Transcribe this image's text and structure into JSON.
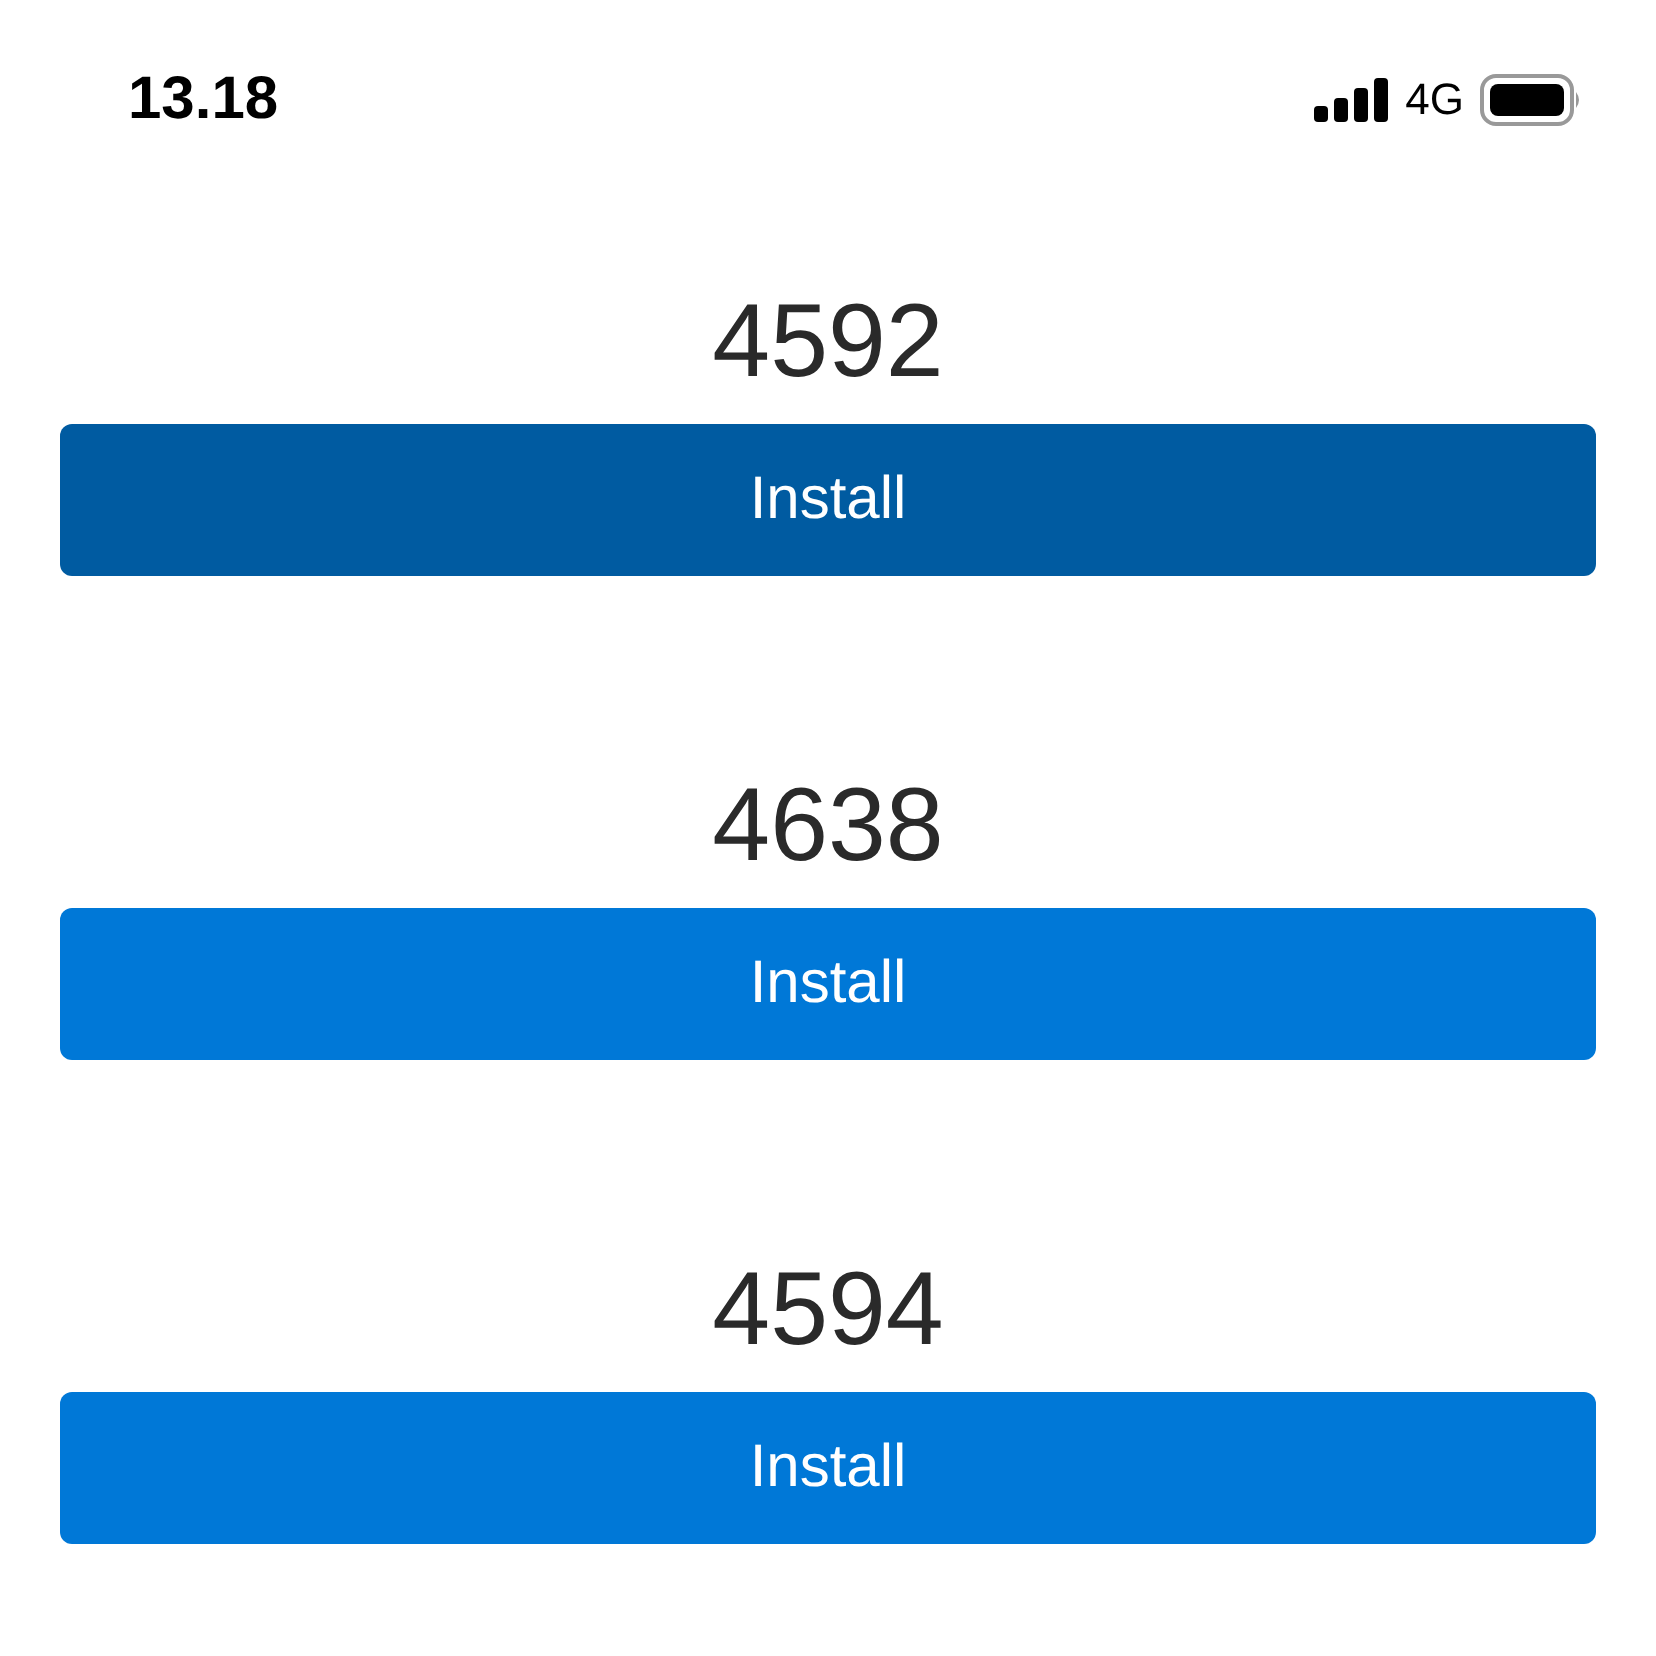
{
  "status_bar": {
    "time": "13.18",
    "network": "4G"
  },
  "items": [
    {
      "number": "4592",
      "button": "Install",
      "selected": true
    },
    {
      "number": "4638",
      "button": "Install",
      "selected": false
    },
    {
      "number": "4594",
      "button": "Install",
      "selected": false
    }
  ]
}
